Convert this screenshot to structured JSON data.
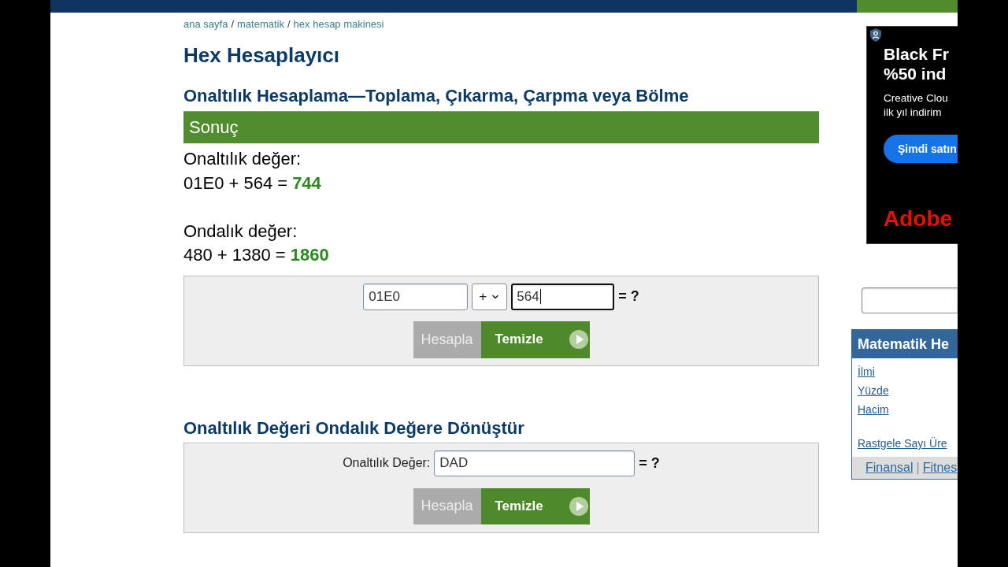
{
  "breadcrumb": [
    {
      "kind": "link",
      "text": "ana sayfa"
    },
    {
      "kind": "separator",
      "text": "/"
    },
    {
      "kind": "link",
      "text": "matematik"
    },
    {
      "kind": "separator",
      "text": "/"
    },
    {
      "kind": "link",
      "text": "hex hesap makinesi"
    }
  ],
  "title": "Hex Hesaplayıcı",
  "calculator": {
    "heading": "Onaltılık Hesaplama—Toplama, Çıkarma, Çarpma veya Bölme",
    "result": {
      "header": "Sonuç",
      "blocks": [
        {
          "label": "Onaltılık değer:",
          "expression": "01E0 + 564 =",
          "answer": "744"
        },
        {
          "label": "Ondalık değer:",
          "expression": "480 + 1380 =",
          "answer": "1860"
        }
      ]
    },
    "inputs": [
      {
        "kind": "text",
        "value": "01E0",
        "focused": false
      },
      {
        "kind": "select",
        "value": "+",
        "focused": false
      },
      {
        "kind": "text",
        "value": "564",
        "focused": true
      }
    ],
    "suffix": "= ?",
    "buttons": [
      {
        "label": "Hesapla",
        "highlighted": false
      },
      {
        "label": "Temizle",
        "highlighted": true
      }
    ]
  },
  "converter": {
    "heading": "Onaltılık Değeri Ondalık Değere Dönüştür",
    "label": "Onaltılık Değer:",
    "field": {
      "value": "DAD",
      "focused": false
    },
    "suffix": "= ?",
    "buttons": [
      {
        "label": "Hesapla",
        "highlighted": false
      },
      {
        "label": "Temizle",
        "highlighted": true
      }
    ]
  },
  "ad": {
    "headline": [
      "Black Fr",
      "%50 ind"
    ],
    "body": [
      "Creative Clou",
      "ilk yıl indirim"
    ],
    "button": "Şimdi satın",
    "brand": "Adobe"
  },
  "sidebar": {
    "panel": {
      "title": "Matematik He",
      "link_groups": [
        [
          {
            "text": "İlmi"
          },
          {
            "text": "Yüzde"
          },
          {
            "text": "Hacim"
          }
        ],
        [
          {
            "text": "Rastgele Sayı Üre"
          }
        ]
      ],
      "footer": [
        {
          "kind": "link",
          "text": "Finansal"
        },
        {
          "kind": "separator",
          "text": "|"
        },
        {
          "kind": "link",
          "text": "Fitnes"
        }
      ]
    }
  }
}
